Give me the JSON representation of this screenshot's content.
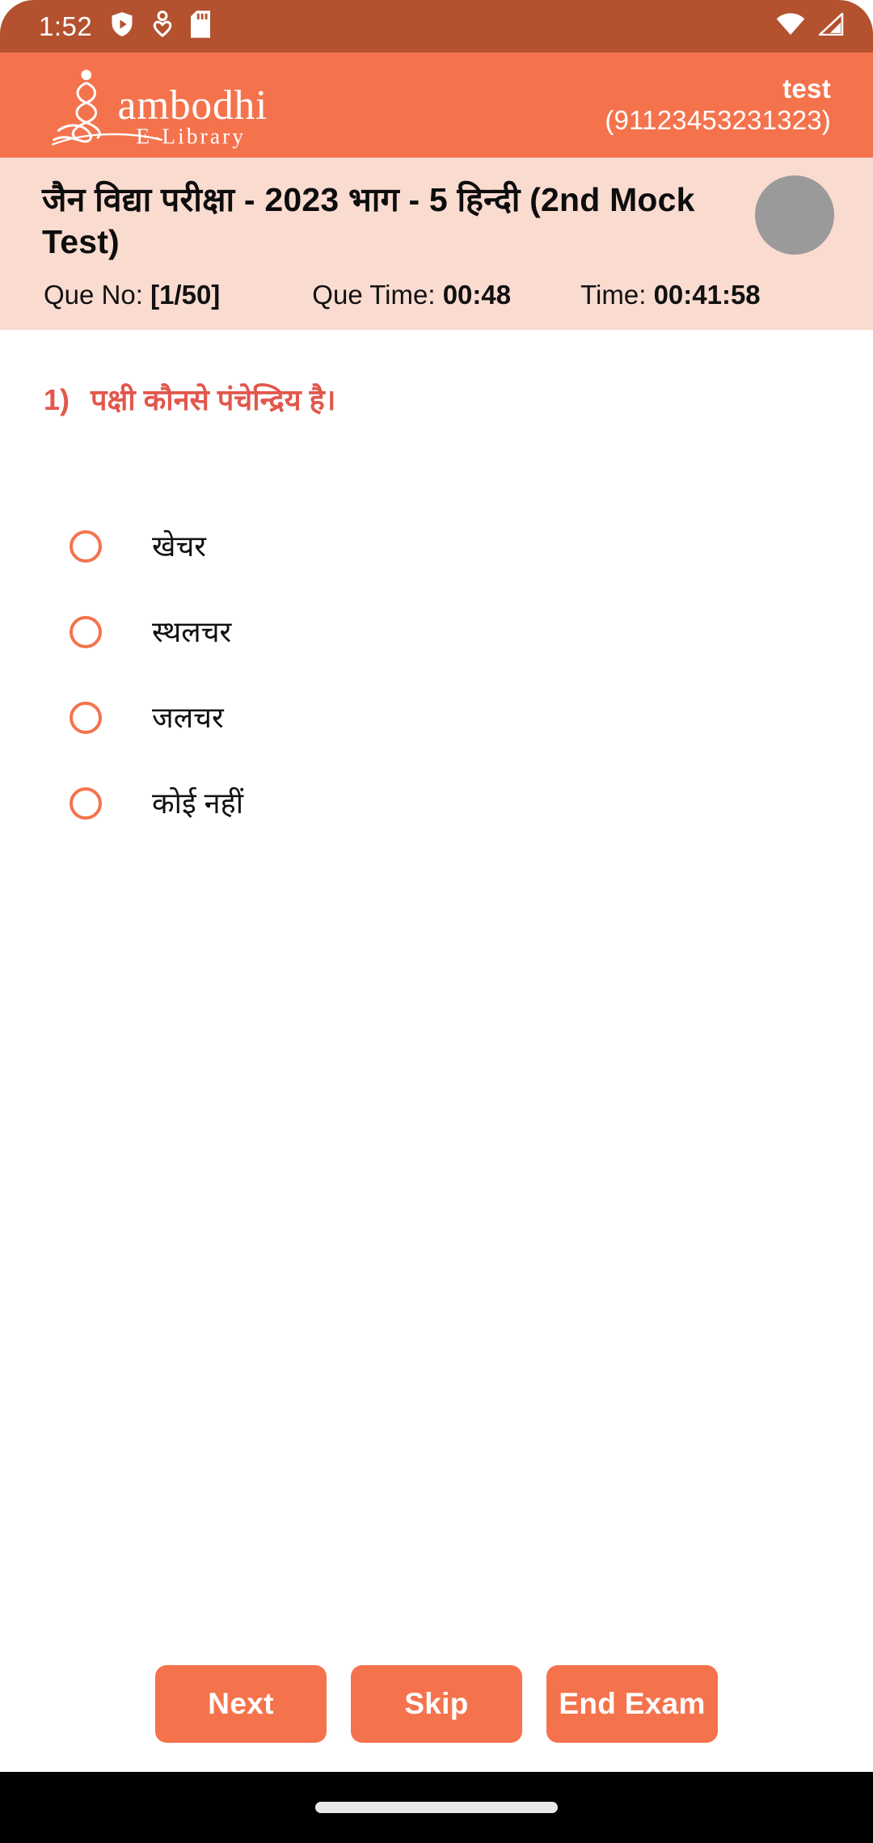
{
  "status_bar": {
    "time": "1:52",
    "icons": [
      "shield-play-icon",
      "person-heart-icon",
      "sd-card-icon"
    ],
    "right_icons": [
      "wifi-icon",
      "signal-icon"
    ],
    "background_color": "#b4512f"
  },
  "app_bar": {
    "logo_text": "ambodhi",
    "logo_subtext": "E-Library",
    "user_name": "test",
    "user_phone": "(91123453231323)",
    "background_color": "#f4734d"
  },
  "exam_info": {
    "title": "जैन विद्या परीक्षा - 2023 भाग - 5 हिन्दी (2nd Mock Test)",
    "que_no_label": "Que No:",
    "que_no_value": "[1/50]",
    "que_time_label": "Que Time:",
    "que_time_value": "00:48",
    "time_label": "Time:",
    "time_value": "00:41:58",
    "background_color": "#fadbd0"
  },
  "question": {
    "number": "1)",
    "text": "पक्षी कौनसे पंचेन्द्रिय है।",
    "color": "#e2574c",
    "options": [
      {
        "label": "खेचर",
        "selected": false
      },
      {
        "label": "स्थलचर",
        "selected": false
      },
      {
        "label": "जलचर",
        "selected": false
      },
      {
        "label": "कोई नहीं",
        "selected": false
      }
    ]
  },
  "footer": {
    "next_label": "Next",
    "skip_label": "Skip",
    "end_exam_label": "End Exam",
    "button_color": "#f4734d"
  }
}
